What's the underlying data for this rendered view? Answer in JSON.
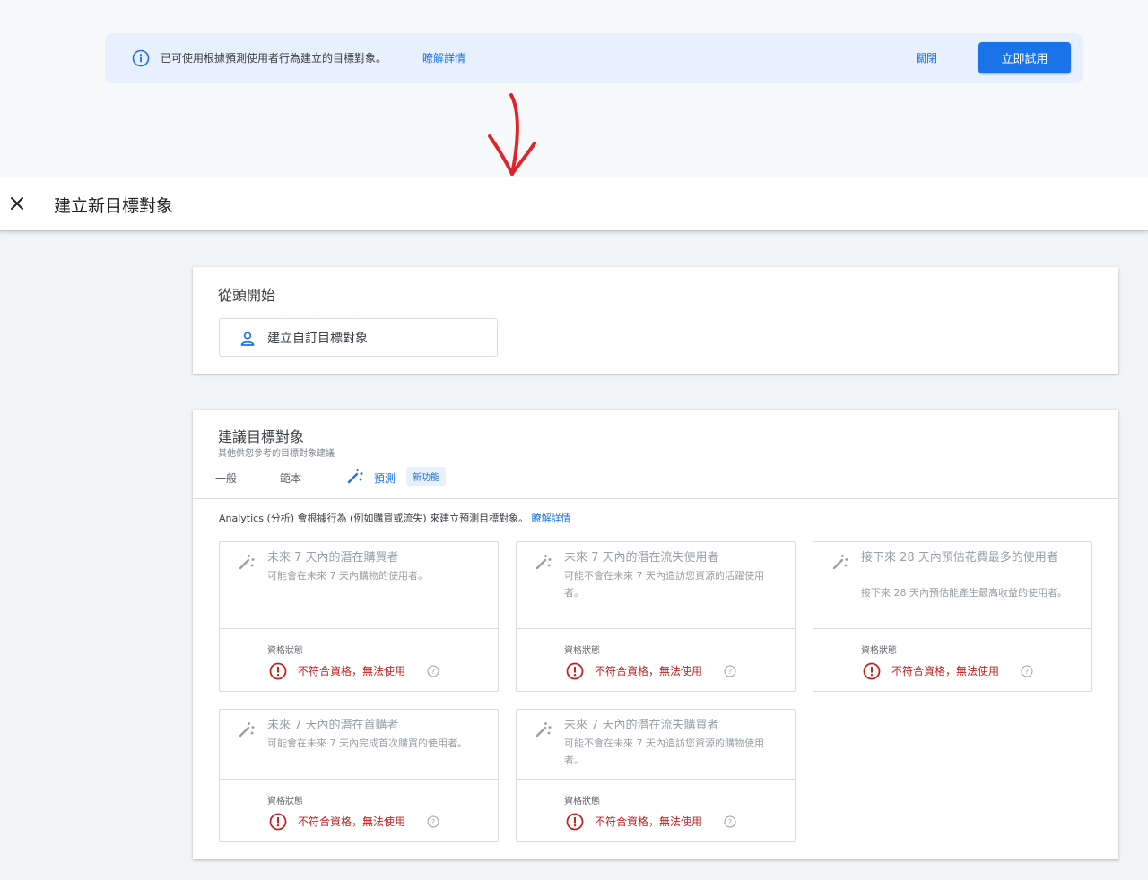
{
  "banner": {
    "message": "已可使用根據預測使用者行為建立的目標對象。",
    "learn_more": "瞭解詳情",
    "close": "關閉",
    "try_now": "立即試用"
  },
  "header": {
    "title": "建立新目標對象"
  },
  "scratch": {
    "heading": "從頭開始",
    "custom_button": "建立自訂目標對象"
  },
  "suggested": {
    "heading": "建議目標對象",
    "subheading": "其他供您參考的目標對象建議",
    "tabs": {
      "general": "一般",
      "template": "範本",
      "predictive": "預測",
      "new_badge": "新功能"
    },
    "description": "Analytics (分析) 會根據行為 (例如購買或流失) 來建立預測目標對象。",
    "learn_more": "瞭解詳情",
    "audiences": [
      {
        "name": "未來 7 天內的潛在購買者",
        "description": "可能會在未來 7 天內購物的使用者。",
        "status_label": "資格狀態",
        "status": "不符合資格，無法使用"
      },
      {
        "name": "未來 7 天內的潛在流失使用者",
        "description": "可能不會在未來 7 天內造訪您資源的活躍使用者。",
        "status_label": "資格狀態",
        "status": "不符合資格，無法使用"
      },
      {
        "name": "接下來 28 天內預估花費最多的使用者",
        "description": "接下來 28 天內預估能產生最高收益的使用者。",
        "status_label": "資格狀態",
        "status": "不符合資格，無法使用"
      },
      {
        "name": "未來 7 天內的潛在首購者",
        "description": "可能會在未來 7 天內完成首次購買的使用者。",
        "status_label": "資格狀態",
        "status": "不符合資格，無法使用"
      },
      {
        "name": "未來 7 天內的潛在流失購買者",
        "description": "可能不會在未來 7 天內造訪您資源的購物使用者。",
        "status_label": "資格狀態",
        "status": "不符合資格，無法使用"
      }
    ]
  },
  "colors": {
    "accent": "#1a73e8",
    "error": "#c5221f",
    "banner_bg": "#e8f0fe"
  }
}
